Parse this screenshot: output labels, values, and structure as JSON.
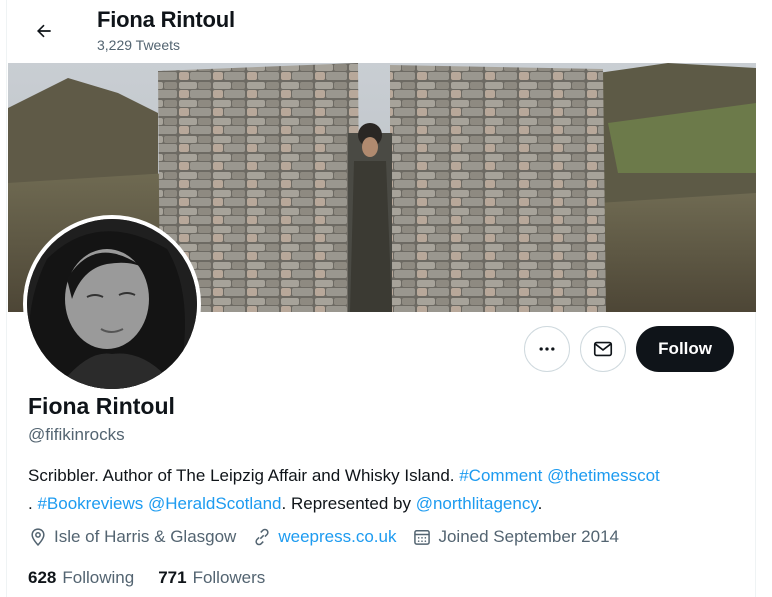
{
  "header": {
    "title": "Fiona Rintoul",
    "tweet_count": "3,229 Tweets"
  },
  "profile": {
    "name": "Fiona Rintoul",
    "handle": "@fifikinrocks",
    "follow_label": "Follow"
  },
  "bio": {
    "text_1": "Scribbler. Author of The Leipzig Affair and Whisky Island. ",
    "tag_comment": "#Comment",
    "mention_times": "@thetimesscot",
    "text_2": ". ",
    "tag_bookreviews": "#Bookreviews",
    "mention_herald": "@HeraldScotland",
    "text_3": ". Represented by ",
    "mention_agency": "@northlitagency",
    "text_4": "."
  },
  "meta": {
    "location": "Isle of Harris & Glasgow",
    "website": "weepress.co.uk",
    "joined": "Joined September 2014"
  },
  "stats": {
    "following_count": "628",
    "following_label": "Following",
    "followers_count": "771",
    "followers_label": "Followers"
  },
  "icons": {
    "back": "arrow-left-icon",
    "more": "more-icon",
    "message": "envelope-icon",
    "location": "location-pin-icon",
    "link": "link-icon",
    "calendar": "calendar-icon"
  },
  "colors": {
    "link": "#1d9bf0",
    "text": "#0f1419",
    "secondary": "#536471",
    "follow_bg": "#0f1419"
  }
}
